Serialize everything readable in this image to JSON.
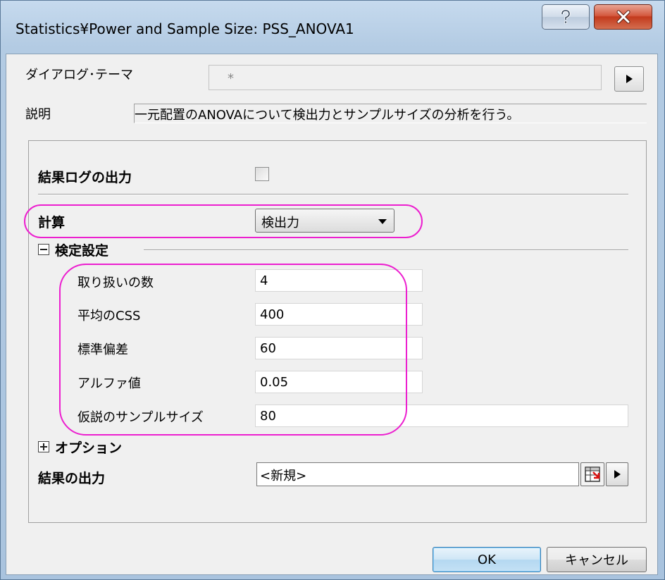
{
  "window": {
    "title": "Statistics¥Power and Sample Size: PSS_ANOVA1",
    "help_glyph": "?",
    "close_glyph": "x"
  },
  "theme": {
    "label": "ダイアログ･テーマ",
    "value": "*"
  },
  "description": {
    "label": "説明",
    "text": "一元配置のANOVAについて検出力とサンプルサイズの分析を行う。"
  },
  "form": {
    "log_output_label": "結果ログの出力",
    "log_output_checked": false,
    "calc_label": "計算",
    "calc_value": "検出力",
    "test_settings_label": "検定設定",
    "fields": [
      {
        "label": "取り扱いの数",
        "value": "4"
      },
      {
        "label": "平均のCSS",
        "value": "400"
      },
      {
        "label": "標準偏差",
        "value": "60"
      },
      {
        "label": "アルファ値",
        "value": "0.05"
      },
      {
        "label": "仮説のサンプルサイズ",
        "value": "80"
      }
    ],
    "options_label": "オプション",
    "result_output_label": "結果の出力",
    "result_output_value": "<新規>"
  },
  "buttons": {
    "ok": "OK",
    "cancel": "キャンセル"
  },
  "colors": {
    "highlight": "#ec1fcf"
  }
}
